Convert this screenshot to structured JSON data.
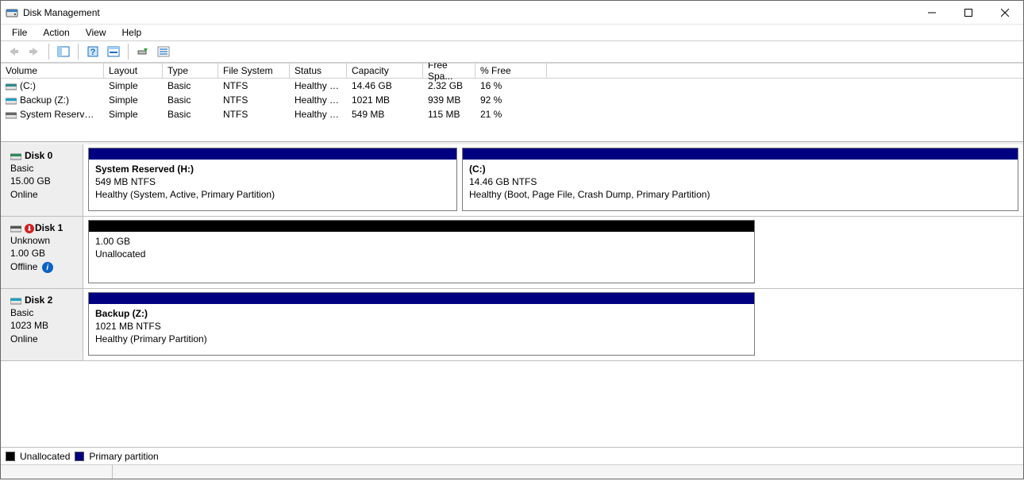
{
  "window": {
    "title": "Disk Management"
  },
  "menu": {
    "items": [
      "File",
      "Action",
      "View",
      "Help"
    ]
  },
  "columns": {
    "volume": "Volume",
    "layout": "Layout",
    "type": "Type",
    "fs": "File System",
    "status": "Status",
    "capacity": "Capacity",
    "free": "Free Spa...",
    "pct": "% Free"
  },
  "volumes": [
    {
      "name": "(C:)",
      "layout": "Simple",
      "type": "Basic",
      "fs": "NTFS",
      "status": "Healthy (B...",
      "capacity": "14.46 GB",
      "free": "2.32 GB",
      "pct": "16 %",
      "iconColor": "#2e8b8b"
    },
    {
      "name": "Backup (Z:)",
      "layout": "Simple",
      "type": "Basic",
      "fs": "NTFS",
      "status": "Healthy (P...",
      "capacity": "1021 MB",
      "free": "939 MB",
      "pct": "92 %",
      "iconColor": "#1fa0c0"
    },
    {
      "name": "System Reserved (...",
      "layout": "Simple",
      "type": "Basic",
      "fs": "NTFS",
      "status": "Healthy (S...",
      "capacity": "549 MB",
      "free": "115 MB",
      "pct": "21 %",
      "iconColor": "#666666"
    }
  ],
  "disks": [
    {
      "name": "Disk 0",
      "kind": "Basic",
      "size": "15.00 GB",
      "state": "Online",
      "iconColor": "#2e8b57",
      "narrow": false,
      "errorDot": false,
      "infoDot": false,
      "parts": [
        {
          "stripe": "primary",
          "title": "System Reserved  (H:)",
          "line2": "549 MB NTFS",
          "line3": "Healthy (System, Active, Primary Partition)",
          "flex": "0 0 465px"
        },
        {
          "stripe": "primary",
          "title": " (C:)",
          "line2": "14.46 GB NTFS",
          "line3": "Healthy (Boot, Page File, Crash Dump, Primary Partition)",
          "flex": "1 1 auto"
        }
      ]
    },
    {
      "name": "Disk 1",
      "kind": "Unknown",
      "size": "1.00 GB",
      "state": "Offline",
      "iconColor": "#555555",
      "narrow": true,
      "errorDot": true,
      "infoDot": true,
      "parts": [
        {
          "stripe": "unalloc",
          "title": "",
          "line2": "1.00 GB",
          "line3": "Unallocated",
          "flex": "1 1 auto"
        }
      ]
    },
    {
      "name": "Disk 2",
      "kind": "Basic",
      "size": "1023 MB",
      "state": "Online",
      "iconColor": "#1fa0c0",
      "narrow": true,
      "errorDot": false,
      "infoDot": false,
      "parts": [
        {
          "stripe": "primary",
          "title": "Backup  (Z:)",
          "line2": "1021 MB NTFS",
          "line3": "Healthy (Primary Partition)",
          "flex": "1 1 auto"
        }
      ]
    }
  ],
  "legend": {
    "unallocated": "Unallocated",
    "primary": "Primary partition"
  }
}
